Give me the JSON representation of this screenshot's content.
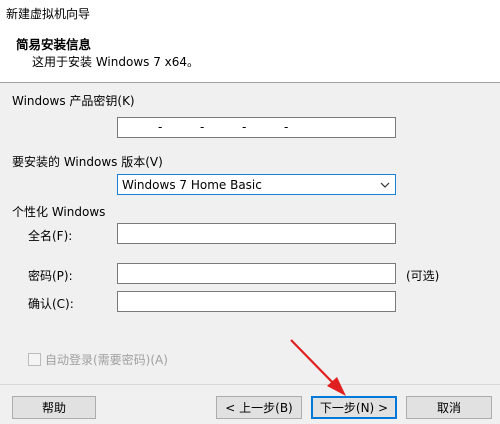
{
  "window": {
    "title": "新建虚拟机向导"
  },
  "header": {
    "title": "简易安装信息",
    "subtitle": "这用于安装 Windows 7 x64。"
  },
  "product_key": {
    "label": "Windows 产品密钥(K)",
    "dashes": [
      "-",
      "-",
      "-",
      "-"
    ]
  },
  "version": {
    "label": "要安装的 Windows 版本(V)",
    "selected": "Windows 7 Home Basic"
  },
  "personalize": {
    "section_label": "个性化 Windows",
    "fullname_label": "全名(F):",
    "password_label": "密码(P):",
    "optional_label": "(可选)",
    "confirm_label": "确认(C):"
  },
  "autologin": {
    "label": "自动登录(需要密码)(A)"
  },
  "buttons": {
    "help": "帮助",
    "back": "< 上一步(B)",
    "next": "下一步(N) >",
    "cancel": "取消"
  },
  "colors": {
    "accent": "#0078d7",
    "arrow": "#e02020"
  }
}
